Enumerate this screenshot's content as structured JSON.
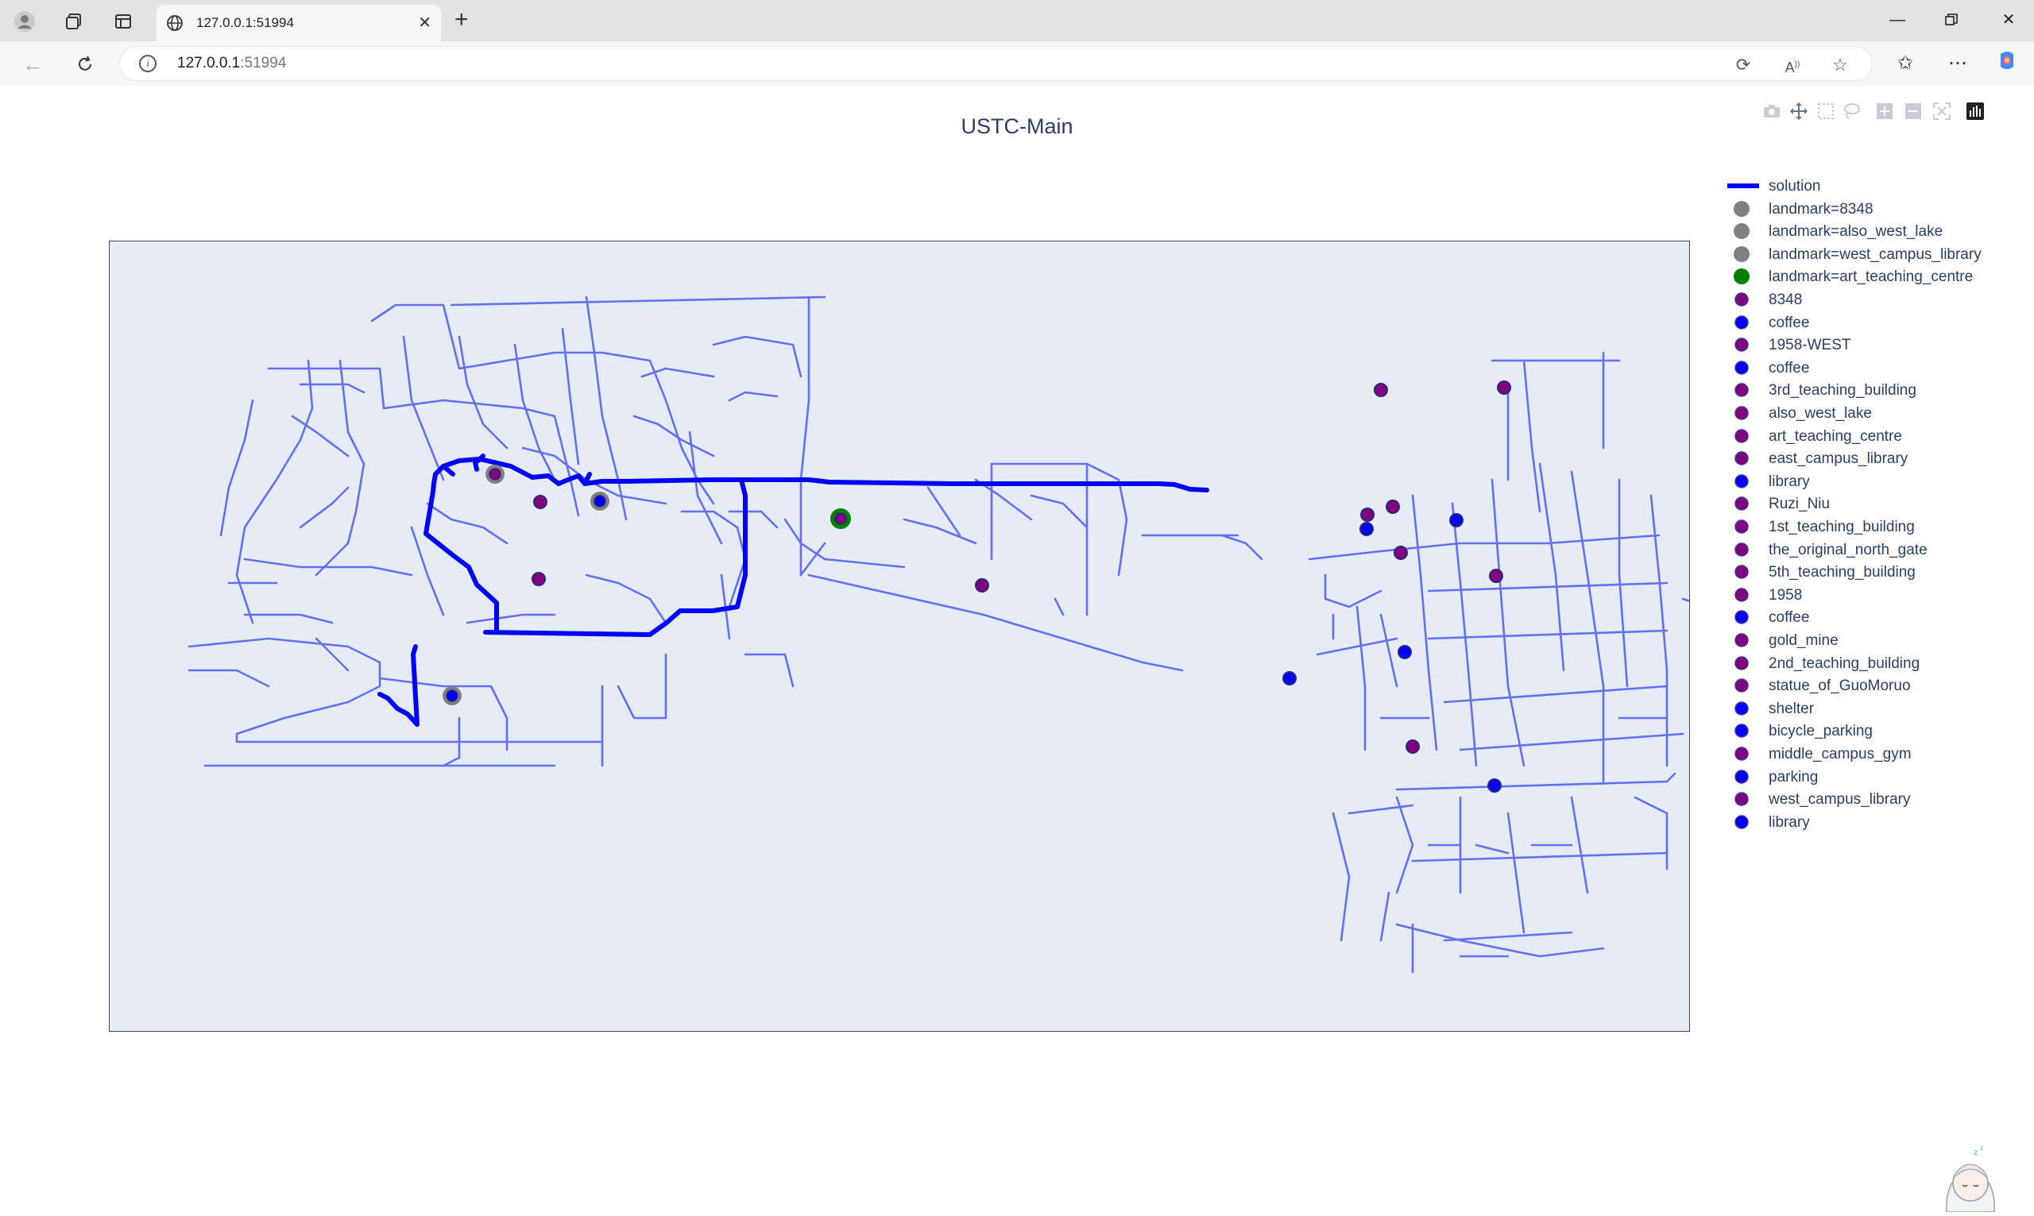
{
  "browser": {
    "tab_title": "127.0.0.1:51994",
    "url_host": "127.0.0.1",
    "url_port": ":51994"
  },
  "chart": {
    "title": "USTC-Main",
    "modebar_buttons": [
      "camera-icon",
      "pan-icon",
      "box-select-icon",
      "lasso-icon",
      "zoom-in-icon",
      "zoom-out-icon",
      "autoscale-icon",
      "plotly-logo-icon"
    ]
  },
  "legend": [
    {
      "label": "solution",
      "kind": "line",
      "color": "#0000ff"
    },
    {
      "label": "landmark=8348",
      "kind": "dot",
      "color": "#808080"
    },
    {
      "label": "landmark=also_west_lake",
      "kind": "dot",
      "color": "#808080"
    },
    {
      "label": "landmark=west_campus_library",
      "kind": "dot",
      "color": "#808080"
    },
    {
      "label": "landmark=art_teaching_centre",
      "kind": "dot",
      "color": "#008000"
    },
    {
      "label": "8348",
      "kind": "dot",
      "color": "#800080"
    },
    {
      "label": "coffee",
      "kind": "dot",
      "color": "#0000ff"
    },
    {
      "label": "1958-WEST",
      "kind": "dot",
      "color": "#800080"
    },
    {
      "label": "coffee",
      "kind": "dot",
      "color": "#0000ff"
    },
    {
      "label": "3rd_teaching_building",
      "kind": "dot",
      "color": "#800080"
    },
    {
      "label": "also_west_lake",
      "kind": "dot",
      "color": "#800080"
    },
    {
      "label": "art_teaching_centre",
      "kind": "dot",
      "color": "#800080"
    },
    {
      "label": "east_campus_library",
      "kind": "dot",
      "color": "#800080"
    },
    {
      "label": "library",
      "kind": "dot",
      "color": "#0000ff"
    },
    {
      "label": "Ruzi_Niu",
      "kind": "dot",
      "color": "#800080"
    },
    {
      "label": "1st_teaching_building",
      "kind": "dot",
      "color": "#800080"
    },
    {
      "label": "the_original_north_gate",
      "kind": "dot",
      "color": "#800080"
    },
    {
      "label": "5th_teaching_building",
      "kind": "dot",
      "color": "#800080"
    },
    {
      "label": "1958",
      "kind": "dot",
      "color": "#800080"
    },
    {
      "label": "coffee",
      "kind": "dot",
      "color": "#0000ff"
    },
    {
      "label": "gold_mine",
      "kind": "dot",
      "color": "#800080"
    },
    {
      "label": "2nd_teaching_building",
      "kind": "dot",
      "color": "#800080"
    },
    {
      "label": "statue_of_GuoMoruo",
      "kind": "dot",
      "color": "#800080"
    },
    {
      "label": "shelter",
      "kind": "dot",
      "color": "#0000ff"
    },
    {
      "label": "bicycle_parking",
      "kind": "dot",
      "color": "#0000ff"
    },
    {
      "label": "middle_campus_gym",
      "kind": "dot",
      "color": "#800080"
    },
    {
      "label": "parking",
      "kind": "dot",
      "color": "#0000ff"
    },
    {
      "label": "west_campus_library",
      "kind": "dot",
      "color": "#800080"
    },
    {
      "label": "library",
      "kind": "dot",
      "color": "#0000ff"
    }
  ],
  "colors": {
    "road": "#6470f0",
    "solution": "#0000ff",
    "plot_bg": "#e5ecf6",
    "landmark_gray": "#808080",
    "landmark_green": "#008000",
    "poi_purple": "#800080",
    "poi_blue": "#0000ff"
  }
}
